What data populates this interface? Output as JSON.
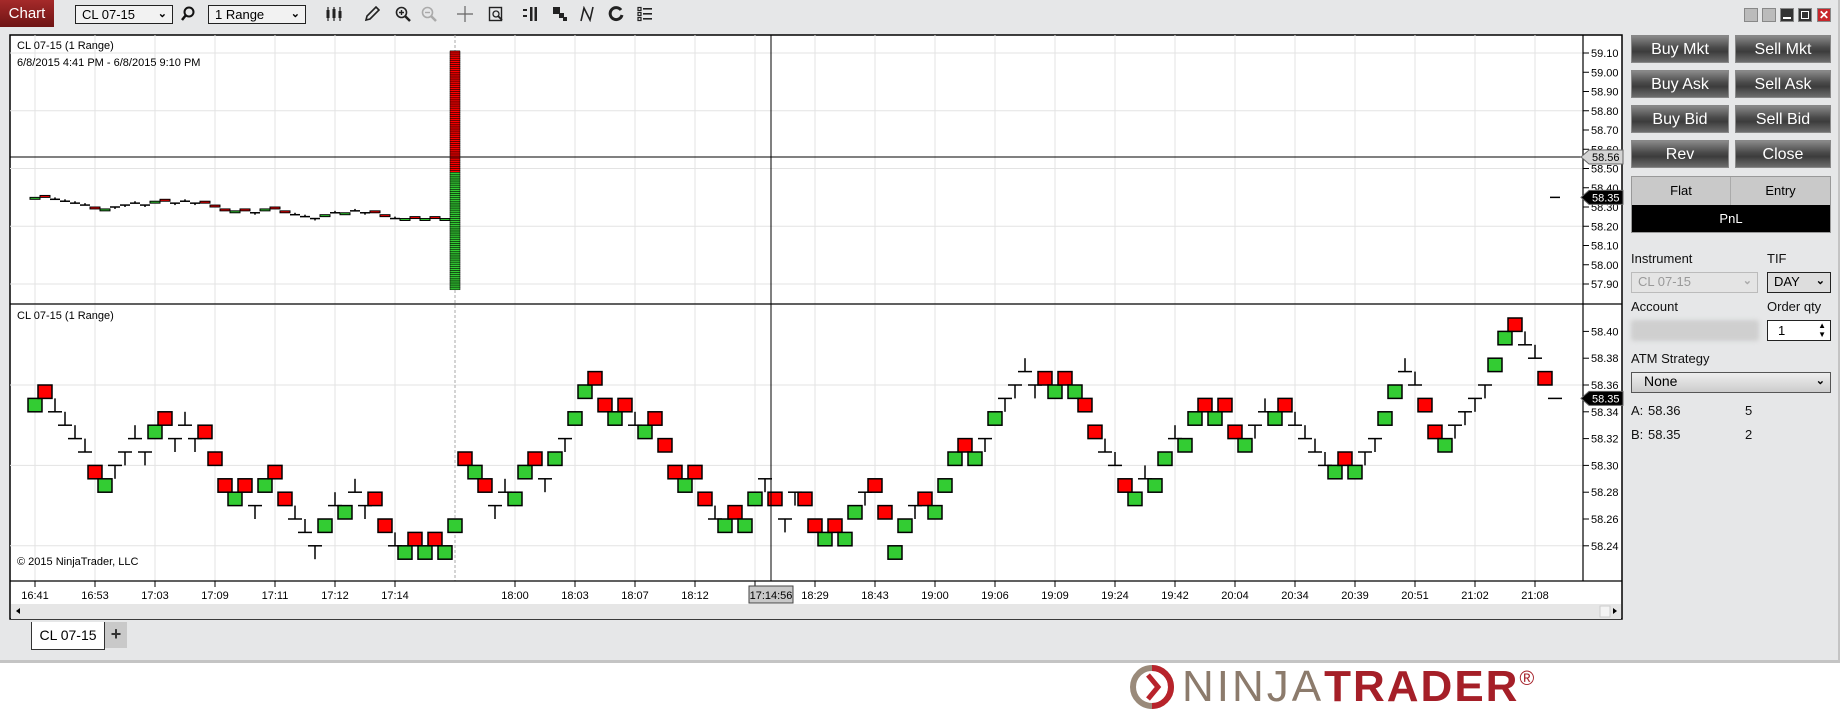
{
  "toolbar": {
    "window_label": "Chart",
    "instrument": "CL 07-15",
    "interval": "1 Range",
    "icons": [
      "search-icon",
      "bar-type-icon",
      "pencil-icon",
      "zoom-in-icon",
      "zoom-out-icon",
      "crosshair-icon",
      "data-box-icon",
      "chart-style-icon",
      "drawing-objects-icon",
      "strategies-icon",
      "refresh-icon",
      "properties-list-icon"
    ]
  },
  "chart": {
    "top_title": "CL 07-15 (1 Range)",
    "date_range": "6/8/2015 4:41 PM - 6/8/2015 9:10 PM",
    "bottom_title": "CL 07-15 (1 Range)",
    "copyright": "© 2015 NinjaTrader, LLC",
    "colors": {
      "up": "#33cc33",
      "down": "#ff0000",
      "grid": "#e3e3e3"
    }
  },
  "chart_data": {
    "type": "range-bar (ohlc)",
    "top_panel": {
      "y_ticks": [
        "59.10",
        "59.00",
        "58.90",
        "58.80",
        "58.70",
        "58.60",
        "58.50",
        "58.40",
        "58.30",
        "58.20",
        "58.10",
        "58.00",
        "57.90"
      ],
      "ylim": [
        57.86,
        59.19
      ],
      "grid_y": [
        59.1,
        58.8,
        58.5,
        58.2,
        57.9
      ],
      "bars_shown": 42,
      "spike_bar": {
        "index": 42,
        "high": 59.11,
        "low": 57.88,
        "down_above": 58.49
      },
      "crosshair_price": "58.56",
      "last_price": "58.35"
    },
    "bottom_panel": {
      "y_ticks": [
        "58.40",
        "58.38",
        "58.36",
        "58.34",
        "58.32",
        "58.30",
        "58.28",
        "58.26",
        "58.24"
      ],
      "ylim": [
        58.22,
        58.44
      ],
      "grid_y": [
        58.36,
        58.3,
        58.24
      ],
      "last_price": "58.35"
    },
    "x_ticks": [
      {
        "i": 0,
        "label": "16:41"
      },
      {
        "i": 6,
        "label": "16:53"
      },
      {
        "i": 12,
        "label": "17:03"
      },
      {
        "i": 18,
        "label": "17:09"
      },
      {
        "i": 24,
        "label": "17:11"
      },
      {
        "i": 30,
        "label": "17:12"
      },
      {
        "i": 36,
        "label": "17:14"
      },
      {
        "i": 48,
        "label": "18:00"
      },
      {
        "i": 54,
        "label": "18:03"
      },
      {
        "i": 60,
        "label": "18:07"
      },
      {
        "i": 66,
        "label": "18:12"
      },
      {
        "i": 72,
        "label": ""
      },
      {
        "i": 78,
        "label": "18:29"
      },
      {
        "i": 84,
        "label": "18:43"
      },
      {
        "i": 90,
        "label": "19:00"
      },
      {
        "i": 96,
        "label": "19:06"
      },
      {
        "i": 102,
        "label": "19:09"
      },
      {
        "i": 108,
        "label": "19:24"
      },
      {
        "i": 114,
        "label": "19:42"
      },
      {
        "i": 120,
        "label": "20:04"
      },
      {
        "i": 126,
        "label": "20:34"
      },
      {
        "i": 132,
        "label": "20:39"
      },
      {
        "i": 138,
        "label": "20:51"
      },
      {
        "i": 144,
        "label": "21:02"
      },
      {
        "i": 150,
        "label": "21:08"
      }
    ],
    "session_break_index": 42,
    "crosshair": {
      "i": 73,
      "label": "17:14:56"
    },
    "bars_ohlc": [
      [
        58.34,
        58.35,
        58.34,
        58.35
      ],
      [
        58.36,
        58.36,
        58.35,
        58.35
      ],
      [
        58.34,
        58.35,
        58.34,
        58.34
      ],
      [
        58.33,
        58.34,
        58.33,
        58.33
      ],
      [
        58.32,
        58.33,
        58.32,
        58.32
      ],
      [
        58.31,
        58.32,
        58.31,
        58.31
      ],
      [
        58.3,
        58.3,
        58.29,
        58.29
      ],
      [
        58.28,
        58.29,
        58.28,
        58.29
      ],
      [
        58.3,
        58.3,
        58.29,
        58.3
      ],
      [
        58.31,
        58.31,
        58.3,
        58.31
      ],
      [
        58.32,
        58.33,
        58.32,
        58.32
      ],
      [
        58.31,
        58.31,
        58.3,
        58.31
      ],
      [
        58.32,
        58.33,
        58.32,
        58.33
      ],
      [
        58.34,
        58.34,
        58.33,
        58.33
      ],
      [
        58.32,
        58.32,
        58.31,
        58.32
      ],
      [
        58.33,
        58.34,
        58.33,
        58.33
      ],
      [
        58.32,
        58.32,
        58.31,
        58.32
      ],
      [
        58.33,
        58.33,
        58.32,
        58.32
      ],
      [
        58.31,
        58.31,
        58.3,
        58.3
      ],
      [
        58.29,
        58.29,
        58.28,
        58.28
      ],
      [
        58.27,
        58.28,
        58.27,
        58.28
      ],
      [
        58.29,
        58.29,
        58.28,
        58.28
      ],
      [
        58.27,
        58.27,
        58.26,
        58.27
      ],
      [
        58.28,
        58.29,
        58.28,
        58.29
      ],
      [
        58.3,
        58.3,
        58.29,
        58.29
      ],
      [
        58.28,
        58.28,
        58.27,
        58.27
      ],
      [
        58.26,
        58.27,
        58.26,
        58.26
      ],
      [
        58.25,
        58.26,
        58.25,
        58.25
      ],
      [
        58.24,
        58.24,
        58.23,
        58.24
      ],
      [
        58.25,
        58.26,
        58.25,
        58.26
      ],
      [
        58.27,
        58.28,
        58.27,
        58.27
      ],
      [
        58.26,
        58.27,
        58.26,
        58.27
      ],
      [
        58.28,
        58.29,
        58.28,
        58.28
      ],
      [
        58.27,
        58.27,
        58.26,
        58.27
      ],
      [
        58.28,
        58.28,
        58.27,
        58.27
      ],
      [
        58.26,
        58.26,
        58.25,
        58.25
      ],
      [
        58.24,
        58.25,
        58.24,
        58.24
      ],
      [
        58.23,
        58.24,
        58.23,
        58.24
      ],
      [
        58.25,
        58.25,
        58.24,
        58.24
      ],
      [
        58.23,
        58.24,
        58.23,
        58.24
      ],
      [
        58.25,
        58.25,
        58.24,
        58.24
      ],
      [
        58.23,
        58.24,
        58.23,
        58.24
      ],
      [
        58.25,
        58.26,
        58.25,
        58.26
      ],
      [
        58.31,
        58.31,
        58.3,
        58.3
      ],
      [
        58.29,
        58.3,
        58.29,
        58.3
      ],
      [
        58.29,
        58.29,
        58.28,
        58.28
      ],
      [
        58.27,
        58.27,
        58.26,
        58.27
      ],
      [
        58.28,
        58.29,
        58.28,
        58.28
      ],
      [
        58.27,
        58.28,
        58.27,
        58.28
      ],
      [
        58.29,
        58.3,
        58.29,
        58.3
      ],
      [
        58.31,
        58.31,
        58.3,
        58.3
      ],
      [
        58.29,
        58.29,
        58.28,
        58.29
      ],
      [
        58.3,
        58.31,
        58.3,
        58.31
      ],
      [
        58.32,
        58.32,
        58.31,
        58.32
      ],
      [
        58.33,
        58.34,
        58.33,
        58.34
      ],
      [
        58.35,
        58.36,
        58.35,
        58.36
      ],
      [
        58.37,
        58.37,
        58.36,
        58.36
      ],
      [
        58.35,
        58.35,
        58.34,
        58.34
      ],
      [
        58.33,
        58.34,
        58.33,
        58.34
      ],
      [
        58.35,
        58.35,
        58.34,
        58.34
      ],
      [
        58.33,
        58.34,
        58.33,
        58.33
      ],
      [
        58.32,
        58.33,
        58.32,
        58.33
      ],
      [
        58.34,
        58.34,
        58.33,
        58.33
      ],
      [
        58.32,
        58.32,
        58.31,
        58.31
      ],
      [
        58.3,
        58.3,
        58.29,
        58.29
      ],
      [
        58.28,
        58.29,
        58.28,
        58.29
      ],
      [
        58.3,
        58.3,
        58.29,
        58.29
      ],
      [
        58.28,
        58.28,
        58.27,
        58.27
      ],
      [
        58.26,
        58.27,
        58.26,
        58.26
      ],
      [
        58.25,
        58.26,
        58.25,
        58.26
      ],
      [
        58.27,
        58.27,
        58.26,
        58.26
      ],
      [
        58.25,
        58.26,
        58.25,
        58.26
      ],
      [
        58.27,
        58.28,
        58.27,
        58.28
      ],
      [
        58.29,
        58.29,
        58.28,
        58.29
      ],
      [
        58.28,
        58.28,
        58.27,
        58.27
      ],
      [
        58.26,
        58.26,
        58.25,
        58.26
      ],
      [
        58.28,
        58.28,
        58.27,
        58.28
      ],
      [
        58.28,
        58.28,
        58.27,
        58.27
      ],
      [
        58.26,
        58.26,
        58.25,
        58.25
      ],
      [
        58.24,
        58.25,
        58.24,
        58.25
      ],
      [
        58.26,
        58.26,
        58.25,
        58.25
      ],
      [
        58.24,
        58.25,
        58.24,
        58.25
      ],
      [
        58.26,
        58.27,
        58.26,
        58.27
      ],
      [
        58.28,
        58.28,
        58.27,
        58.28
      ],
      [
        58.29,
        58.29,
        58.28,
        58.28
      ],
      [
        58.27,
        58.27,
        58.26,
        58.26
      ],
      [
        58.23,
        58.24,
        58.23,
        58.24
      ],
      [
        58.25,
        58.26,
        58.25,
        58.26
      ],
      [
        58.27,
        58.27,
        58.26,
        58.27
      ],
      [
        58.28,
        58.28,
        58.27,
        58.27
      ],
      [
        58.26,
        58.27,
        58.26,
        58.27
      ],
      [
        58.28,
        58.29,
        58.28,
        58.29
      ],
      [
        58.3,
        58.31,
        58.3,
        58.31
      ],
      [
        58.32,
        58.32,
        58.31,
        58.31
      ],
      [
        58.3,
        58.31,
        58.3,
        58.31
      ],
      [
        58.32,
        58.32,
        58.31,
        58.32
      ],
      [
        58.33,
        58.34,
        58.33,
        58.34
      ],
      [
        58.35,
        58.35,
        58.34,
        58.35
      ],
      [
        58.36,
        58.36,
        58.35,
        58.36
      ],
      [
        58.37,
        58.38,
        58.37,
        58.37
      ],
      [
        58.36,
        58.36,
        58.35,
        58.36
      ],
      [
        58.37,
        58.37,
        58.36,
        58.36
      ],
      [
        58.35,
        58.36,
        58.35,
        58.36
      ],
      [
        58.37,
        58.37,
        58.36,
        58.36
      ],
      [
        58.35,
        58.36,
        58.35,
        58.36
      ],
      [
        58.35,
        58.35,
        58.34,
        58.34
      ],
      [
        58.33,
        58.33,
        58.32,
        58.32
      ],
      [
        58.31,
        58.32,
        58.31,
        58.31
      ],
      [
        58.3,
        58.31,
        58.3,
        58.3
      ],
      [
        58.29,
        58.29,
        58.28,
        58.28
      ],
      [
        58.27,
        58.28,
        58.27,
        58.28
      ],
      [
        58.29,
        58.3,
        58.29,
        58.29
      ],
      [
        58.28,
        58.29,
        58.28,
        58.29
      ],
      [
        58.3,
        58.31,
        58.3,
        58.31
      ],
      [
        58.32,
        58.33,
        58.32,
        58.32
      ],
      [
        58.31,
        58.32,
        58.31,
        58.32
      ],
      [
        58.33,
        58.34,
        58.33,
        58.34
      ],
      [
        58.35,
        58.35,
        58.34,
        58.34
      ],
      [
        58.33,
        58.34,
        58.33,
        58.34
      ],
      [
        58.35,
        58.35,
        58.34,
        58.34
      ],
      [
        58.33,
        58.33,
        58.32,
        58.32
      ],
      [
        58.31,
        58.32,
        58.31,
        58.32
      ],
      [
        58.33,
        58.33,
        58.32,
        58.33
      ],
      [
        58.34,
        58.35,
        58.34,
        58.34
      ],
      [
        58.33,
        58.34,
        58.33,
        58.34
      ],
      [
        58.35,
        58.35,
        58.34,
        58.34
      ],
      [
        58.33,
        58.34,
        58.33,
        58.33
      ],
      [
        58.32,
        58.33,
        58.32,
        58.32
      ],
      [
        58.31,
        58.32,
        58.31,
        58.31
      ],
      [
        58.3,
        58.31,
        58.3,
        58.3
      ],
      [
        58.29,
        58.3,
        58.29,
        58.3
      ],
      [
        58.31,
        58.31,
        58.3,
        58.3
      ],
      [
        58.29,
        58.3,
        58.29,
        58.3
      ],
      [
        58.31,
        58.31,
        58.3,
        58.31
      ],
      [
        58.32,
        58.32,
        58.31,
        58.32
      ],
      [
        58.33,
        58.34,
        58.33,
        58.34
      ],
      [
        58.35,
        58.36,
        58.35,
        58.36
      ],
      [
        58.37,
        58.38,
        58.37,
        58.37
      ],
      [
        58.36,
        58.37,
        58.36,
        58.36
      ],
      [
        58.35,
        58.35,
        58.34,
        58.34
      ],
      [
        58.33,
        58.33,
        58.32,
        58.32
      ],
      [
        58.31,
        58.32,
        58.31,
        58.32
      ],
      [
        58.33,
        58.33,
        58.32,
        58.33
      ],
      [
        58.34,
        58.34,
        58.33,
        58.34
      ],
      [
        58.35,
        58.35,
        58.34,
        58.35
      ],
      [
        58.36,
        58.36,
        58.35,
        58.36
      ],
      [
        58.37,
        58.38,
        58.37,
        58.38
      ],
      [
        58.39,
        58.4,
        58.39,
        58.4
      ],
      [
        58.41,
        58.41,
        58.4,
        58.4
      ],
      [
        58.39,
        58.4,
        58.39,
        58.39
      ],
      [
        58.38,
        58.39,
        58.38,
        58.38
      ],
      [
        58.37,
        58.37,
        58.36,
        58.36
      ],
      [
        58.35,
        58.35,
        58.35,
        58.35
      ]
    ]
  },
  "order_panel": {
    "buttons": [
      "Buy Mkt",
      "Sell Mkt",
      "Buy Ask",
      "Sell Ask",
      "Buy Bid",
      "Sell Bid",
      "Rev",
      "Close"
    ],
    "position": {
      "flat": "Flat",
      "entry": "Entry",
      "pnl": "PnL"
    },
    "instrument_label": "Instrument",
    "instrument_value": "CL 07-15",
    "tif_label": "TIF",
    "tif_value": "DAY",
    "account_label": "Account",
    "order_qty_label": "Order qty",
    "order_qty": "1",
    "atm_label": "ATM Strategy",
    "atm_value": "None",
    "ask": {
      "label": "A:",
      "price": "58.36",
      "size": "5"
    },
    "bid": {
      "label": "B:",
      "price": "58.35",
      "size": "2"
    }
  },
  "tabs": {
    "active": "CL 07-15",
    "add": "+"
  },
  "logo": {
    "part1": "NINJA",
    "part2": "TRADER",
    "reg": "®",
    "color1": "#8c7b6c",
    "color2": "#a51f28"
  }
}
